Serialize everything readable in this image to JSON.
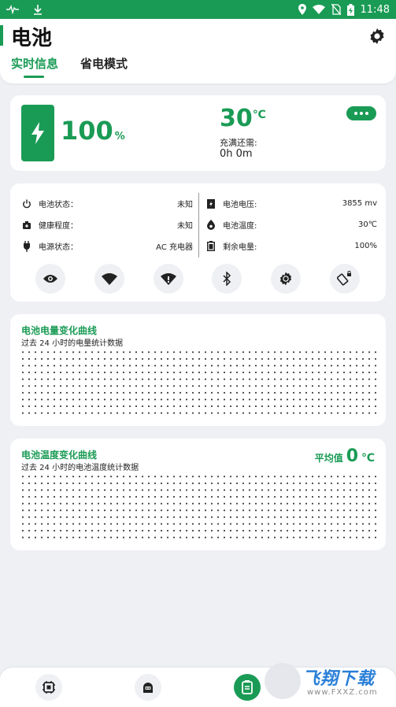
{
  "status_bar": {
    "time": "11:48",
    "icons": [
      "pulse-icon",
      "download-icon",
      "location-icon",
      "wifi-icon",
      "no-sim-icon",
      "battery-charging-icon"
    ]
  },
  "header": {
    "title": "电池",
    "tabs": [
      {
        "label": "实时信息",
        "active": true
      },
      {
        "label": "省电模式",
        "active": false
      }
    ],
    "settings_icon": "gear-icon"
  },
  "battery_card": {
    "percent": "100",
    "percent_unit": "%",
    "temperature": "30",
    "temperature_unit": "℃",
    "charge_label": "充满还需:",
    "charge_time": "0h 0m",
    "more_icon": "more-dots-icon"
  },
  "info": {
    "left": [
      {
        "icon": "power-icon",
        "label": "电池状态：",
        "value": "未知"
      },
      {
        "icon": "health-icon",
        "label": "健康程度：",
        "value": "未知"
      },
      {
        "icon": "plug-icon",
        "label": "电源状态：",
        "value": "AC 充电器"
      }
    ],
    "right": [
      {
        "icon": "voltage-icon",
        "label": "电池电压:",
        "value": "3855 mv"
      },
      {
        "icon": "thermometer-icon",
        "label": "电池温度:",
        "value": "30℃"
      },
      {
        "icon": "battery-level-icon",
        "label": "剩余电量:",
        "value": "100%"
      }
    ],
    "toggles": [
      "eye-icon",
      "wifi-icon",
      "hotspot-icon",
      "bluetooth-icon",
      "brightness-icon",
      "rotate-lock-icon"
    ]
  },
  "charts": {
    "battery": {
      "title": "电池电量变化曲线",
      "subtitle": "过去 24 小时的电量统计数据"
    },
    "temperature": {
      "title": "电池温度变化曲线",
      "subtitle": "过去 24 小时的电池温度统计数据",
      "avg_label": "平均值",
      "avg_value": "0",
      "avg_unit": "℃"
    }
  },
  "bottom_nav": [
    "chip-icon",
    "robot-icon",
    "battery-tab-icon"
  ],
  "watermark": {
    "title": "飞翔下载",
    "url": "www.FXXZ.com"
  },
  "colors": {
    "accent": "#1a9b55",
    "background": "#eef0f4",
    "card": "#ffffff"
  }
}
